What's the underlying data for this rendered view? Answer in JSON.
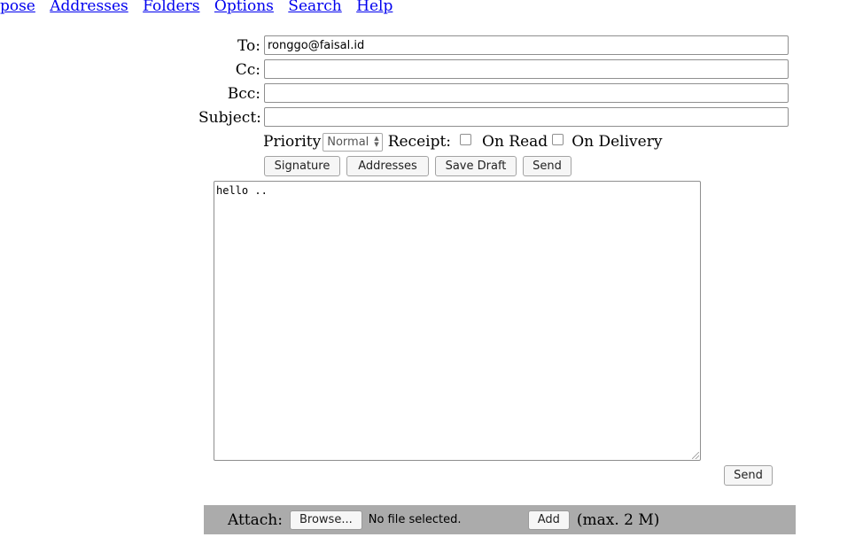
{
  "nav": {
    "items": [
      "npose",
      "Addresses",
      "Folders",
      "Options",
      "Search",
      "Help"
    ]
  },
  "header": {
    "to_label": "To:",
    "to_value": "ronggo@faisal.id",
    "cc_label": "Cc:",
    "cc_value": "",
    "bcc_label": "Bcc:",
    "bcc_value": "",
    "subject_label": "Subject:",
    "subject_value": ""
  },
  "options": {
    "priority_label": "Priority",
    "priority_value": "Normal",
    "receipt_label": "Receipt:",
    "on_read_label": "On Read",
    "on_read_checked": false,
    "on_delivery_label": "On Delivery",
    "on_delivery_checked": false
  },
  "toolbar": {
    "signature_label": "Signature",
    "addresses_label": "Addresses",
    "save_draft_label": "Save Draft",
    "send_label": "Send"
  },
  "body": {
    "text": "hello .."
  },
  "bottom": {
    "send_label": "Send"
  },
  "attach": {
    "label": "Attach:",
    "browse_label": "Browse...",
    "file_status": "No file selected.",
    "add_label": "Add",
    "max_note": "(max. 2 M)"
  }
}
